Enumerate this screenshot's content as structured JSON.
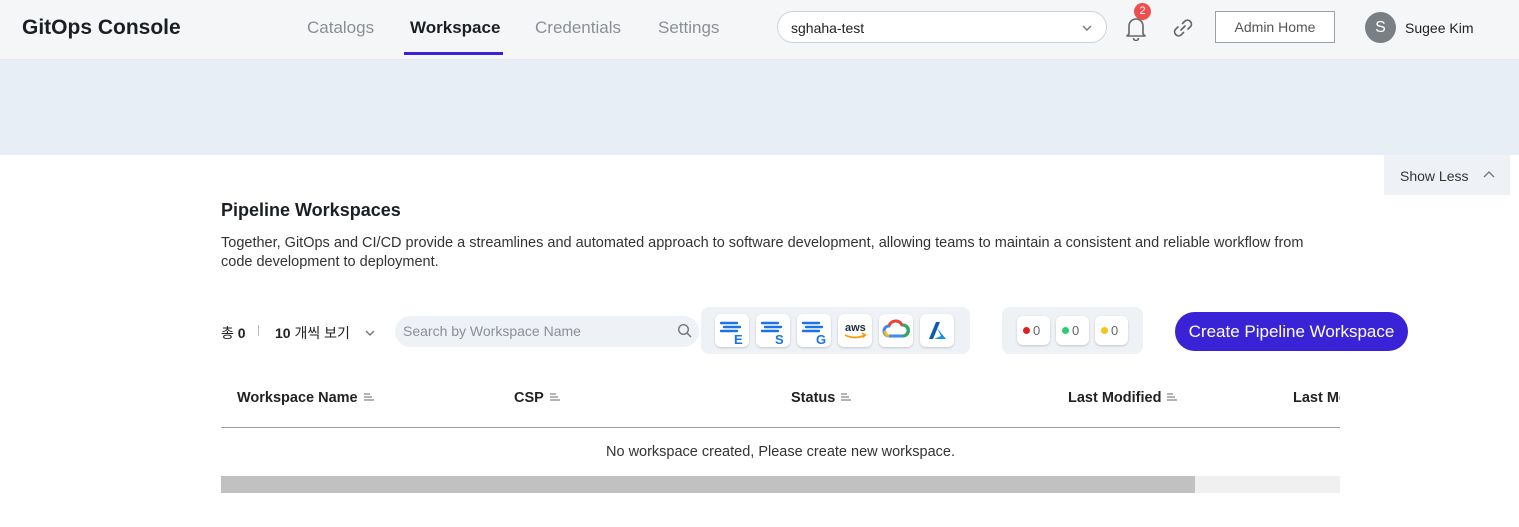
{
  "header": {
    "app_title": "GitOps Console",
    "tabs": [
      {
        "label": "Catalogs",
        "active": false
      },
      {
        "label": "Workspace",
        "active": true
      },
      {
        "label": "Credentials",
        "active": false
      },
      {
        "label": "Settings",
        "active": false
      }
    ],
    "workspace_select": {
      "value": "sghaha-test",
      "icon": "chevron-down-icon"
    },
    "notifications": {
      "count": "2",
      "icon": "bell-icon"
    },
    "link_icon": "link-icon",
    "admin_button": "Admin Home",
    "user": {
      "initial": "S",
      "name": "Sugee Kim"
    },
    "accent_color": "#3a22d6"
  },
  "banner": {
    "show_less_label": "Show Less",
    "show_less_icon": "chevron-up-icon"
  },
  "main": {
    "title": "Pipeline Workspaces",
    "description": "Together, GitOps and CI/CD provide a streamlines and automated approach to software development, allowing teams to maintain a consistent and reliable workflow from code development to deployment.",
    "total_label": "총",
    "total_count": "0",
    "per_page_number": "10",
    "per_page_suffix": "개씩 보기",
    "search_placeholder": "Search by Workspace Name",
    "csp_filters": [
      {
        "name": "filter-e",
        "letter": "E"
      },
      {
        "name": "filter-s",
        "letter": "S"
      },
      {
        "name": "filter-g",
        "letter": "G"
      },
      {
        "name": "aws",
        "letter": "aws"
      },
      {
        "name": "google-cloud",
        "letter": ""
      },
      {
        "name": "azure",
        "letter": ""
      }
    ],
    "status_filters": [
      {
        "color": "#e02020",
        "count": "0"
      },
      {
        "color": "#2ecc71",
        "count": "0"
      },
      {
        "color": "#f5c518",
        "count": "0"
      }
    ],
    "create_button": "Create Pipeline Workspace"
  },
  "table": {
    "columns": [
      "Workspace Name",
      "CSP",
      "Status",
      "Last Modified",
      "Last Modified"
    ],
    "empty_message": "No workspace created, Please create new workspace.",
    "scroll_fraction": 0.87
  }
}
